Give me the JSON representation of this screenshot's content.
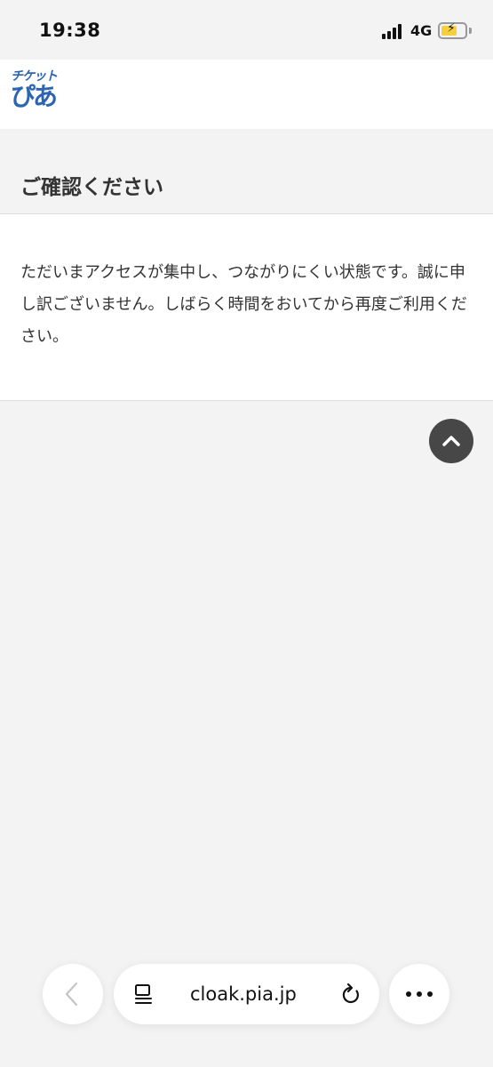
{
  "status_bar": {
    "time": "19:38",
    "network": "4G",
    "battery_color": "#f5d03a"
  },
  "logo": {
    "top_text": "チケット",
    "bottom_text": "ぴあ",
    "brand_color": "#2b64b3"
  },
  "page": {
    "title": "ご確認ください",
    "message": "ただいまアクセスが集中し、つながりにくい状態です。誠に申し訳ございません。しばらく時間をおいてから再度ご利用ください。"
  },
  "scroll_top": {
    "icon": "chevron-up-icon"
  },
  "browser": {
    "url": "cloak.pia.jp",
    "back_icon": "chevron-left-icon",
    "reader_icon": "page-menu-icon",
    "reload_icon": "reload-icon",
    "more_icon": "more-icon"
  }
}
